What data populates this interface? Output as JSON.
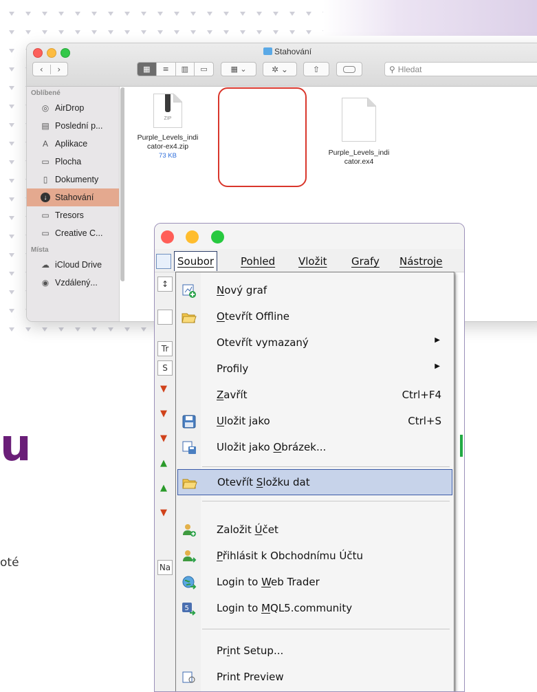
{
  "finder": {
    "title": "Stahování",
    "search_placeholder": "Hledat",
    "sidebar": {
      "favorites_header": "Oblíbené",
      "favorites": [
        {
          "label": "AirDrop",
          "icon": "airdrop-icon"
        },
        {
          "label": "Poslední p...",
          "icon": "recents-icon"
        },
        {
          "label": "Aplikace",
          "icon": "applications-icon"
        },
        {
          "label": "Plocha",
          "icon": "desktop-icon"
        },
        {
          "label": "Dokumenty",
          "icon": "documents-icon"
        },
        {
          "label": "Stahování",
          "icon": "downloads-icon",
          "selected": true
        },
        {
          "label": "Tresors",
          "icon": "folder-icon"
        },
        {
          "label": "Creative C...",
          "icon": "folder-icon"
        }
      ],
      "locations_header": "Místa",
      "locations": [
        {
          "label": "iCloud Drive",
          "icon": "cloud-icon"
        },
        {
          "label": "Vzdálený...",
          "icon": "disc-icon"
        }
      ]
    },
    "files": [
      {
        "name_line1": "Purple_Levels_indi",
        "name_line2": "cator-ex4.zip",
        "size": "73 KB",
        "type_label": "ZIP"
      },
      {
        "name_line1": "Purple_Levels_indi",
        "name_line2": "cator.ex4",
        "highlighted": true
      }
    ]
  },
  "mt4": {
    "menubar": [
      "Soubor",
      "Pohled",
      "Vložit",
      "Grafy",
      "Nástroje"
    ],
    "left_panel_labels": [
      "Tr",
      "S",
      "Na"
    ],
    "menu": [
      {
        "pre": "",
        "acc": "N",
        "post": "ový graf",
        "icon": "new-chart-icon"
      },
      {
        "pre": "",
        "acc": "O",
        "post": "tevřít Offline",
        "icon": "open-folder-icon"
      },
      {
        "pre": "Otevřít vymazaný",
        "acc": "",
        "post": "",
        "submenu": true
      },
      {
        "pre": "Profily",
        "acc": "",
        "post": "",
        "submenu": true
      },
      {
        "pre": "",
        "acc": "Z",
        "post": "avřít",
        "shortcut": "Ctrl+F4"
      },
      {
        "pre": "",
        "acc": "U",
        "post": "ložit jako",
        "shortcut": "Ctrl+S",
        "icon": "save-icon"
      },
      {
        "pre": "Uložit jako ",
        "acc": "O",
        "post": "brázek...",
        "icon": "save-picture-icon"
      },
      {
        "pre": "Otevřít ",
        "acc": "S",
        "post": "ložku dat",
        "icon": "data-folder-icon",
        "highlighted": true
      },
      {
        "pre": "Založit ",
        "acc": "Ú",
        "post": "čet",
        "icon": "add-account-icon"
      },
      {
        "pre": "",
        "acc": "P",
        "post": "řihlásit k Obchodnímu Účtu",
        "icon": "login-account-icon"
      },
      {
        "pre": "Login to ",
        "acc": "W",
        "post": "eb Trader",
        "icon": "web-trader-icon"
      },
      {
        "pre": "Login to ",
        "acc": "M",
        "post": "QL5.community",
        "icon": "mql5-icon"
      },
      {
        "pre": "Pr",
        "acc": "i",
        "post": "nt Setup..."
      },
      {
        "pre": "Print Preview",
        "acc": "",
        "post": "",
        "icon": "print-preview-icon"
      }
    ]
  },
  "background": {
    "heading_fragment": "u",
    "text_fragment": "oté"
  },
  "colors": {
    "accent_purple": "#6a1e78",
    "highlight_red": "#d9362b",
    "menu_highlight": "#c7d3ea",
    "sidebar_selection": "#e4a98f"
  }
}
